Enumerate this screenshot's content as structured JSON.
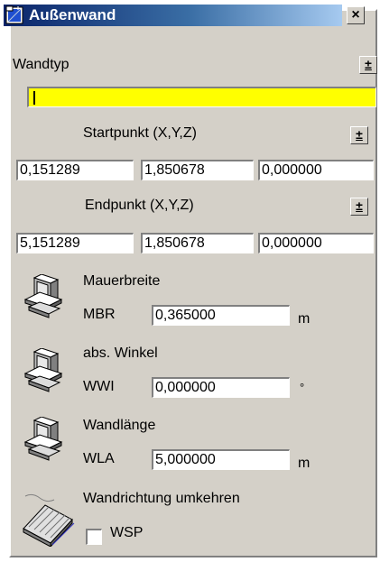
{
  "window": {
    "title": "Außenwand",
    "close_label": "×"
  },
  "wandtyp": {
    "label": "Wandtyp",
    "toggle": "±",
    "value": ""
  },
  "startpunkt": {
    "label": "Startpunkt (X,Y,Z)",
    "toggle": "±",
    "x": "0,151289",
    "y": "1,850678",
    "z": "0,000000"
  },
  "endpunkt": {
    "label": "Endpunkt (X,Y,Z)",
    "toggle": "±",
    "x": "5,151289",
    "y": "1,850678",
    "z": "0,000000"
  },
  "mauerbreite": {
    "label": "Mauerbreite",
    "code": "MBR",
    "value": "0,365000",
    "unit": "m"
  },
  "winkel": {
    "label": "abs. Winkel",
    "code": "WWI",
    "value": "0,000000",
    "unit": "°"
  },
  "wandlaenge": {
    "label": "Wandlänge",
    "code": "WLA",
    "value": "5,000000",
    "unit": "m"
  },
  "wandrichtung": {
    "label": "Wandrichtung umkehren",
    "code": "WSP",
    "checked": false
  },
  "colors": {
    "titlebar": "#0a246a",
    "panel": "#d4d0c8",
    "highlight_field": "#ffff00"
  },
  "icons": {
    "title": "wall-tool-icon",
    "parameter": "computer-icon",
    "reverse": "keyboard-icon"
  }
}
